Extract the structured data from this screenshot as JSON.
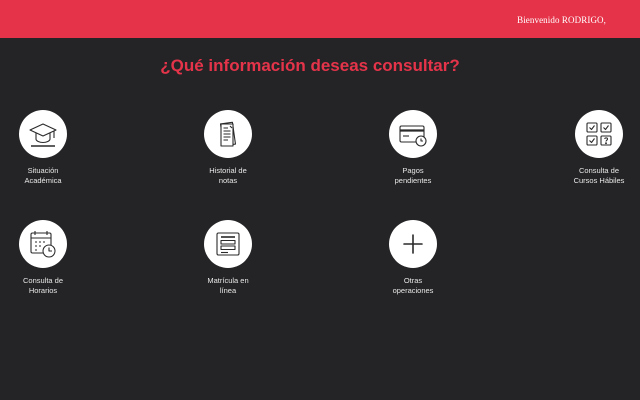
{
  "header": {
    "welcome": "Bienvenido RODRIGO,"
  },
  "heading": "¿Qué información deseas consultar?",
  "options": [
    {
      "icon": "graduation-cap-icon",
      "line1": "Situación",
      "line2": "Académica"
    },
    {
      "icon": "document-notes-icon",
      "line1": "Historial de",
      "line2": "notas"
    },
    {
      "icon": "card-payment-icon",
      "line1": "Pagos",
      "line2": "pendientes"
    },
    {
      "icon": "checklist-grid-icon",
      "line1": "Consulta de",
      "line2": "Cursos Hábiles"
    },
    {
      "icon": "calendar-clock-icon",
      "line1": "Consulta de",
      "line2": "Horarios"
    },
    {
      "icon": "enrollment-form-icon",
      "line1": "Matrícula en",
      "line2": "línea"
    },
    {
      "icon": "plus-icon",
      "line1": "Otras",
      "line2": "operaciones"
    }
  ]
}
